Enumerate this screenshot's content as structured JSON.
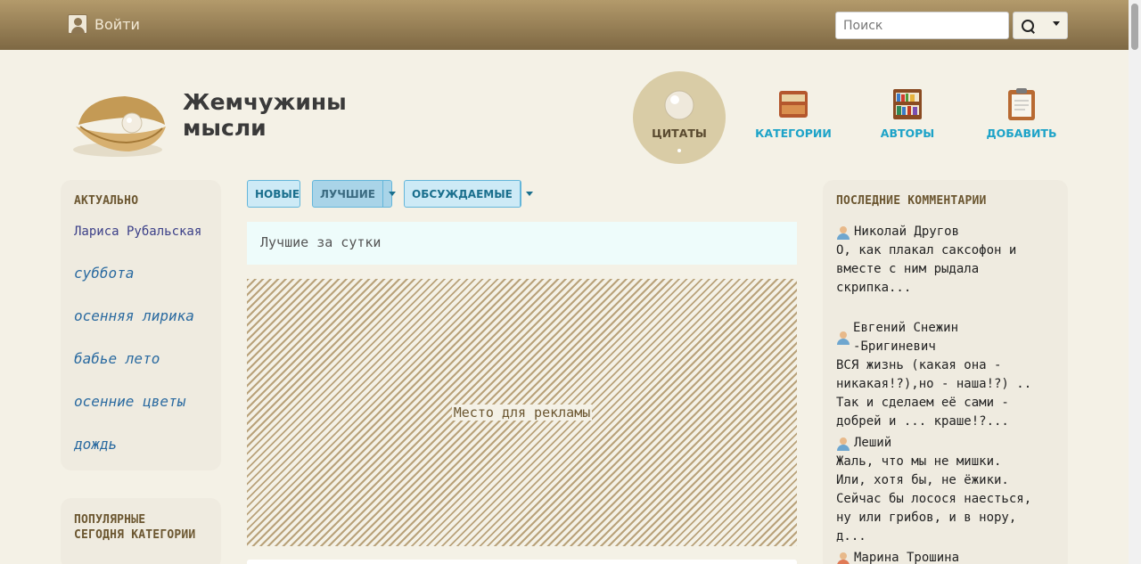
{
  "topbar": {
    "login_label": "Войти",
    "search_placeholder": "Поиск"
  },
  "header": {
    "title_line1": "Жемчужины",
    "title_line2": "мысли",
    "nav": [
      {
        "label": "ЦИТАТЫ",
        "icon": "pearl-icon",
        "active": true
      },
      {
        "label": "КАТЕГОРИИ",
        "icon": "box-icon",
        "active": false
      },
      {
        "label": "АВТОРЫ",
        "icon": "bookshelf-icon",
        "active": false
      },
      {
        "label": "ДОБАВИТЬ",
        "icon": "clipboard-icon",
        "active": false
      }
    ]
  },
  "left": {
    "actual_heading": "АКТУАЛЬНО",
    "links": [
      "Лариса Рубальская",
      "суббота",
      "осенняя лирика",
      "бабье лето",
      "осенние цветы",
      "дождь"
    ],
    "popular_heading_line1": "ПОПУЛЯРНЫЕ",
    "popular_heading_line2": "СЕГОДНЯ КАТЕГОРИИ"
  },
  "main": {
    "tabs": [
      "НОВЫЕ",
      "ЛУЧШИЕ",
      "ОБСУЖДАЕМЫЕ"
    ],
    "subheading": "Лучшие за сутки",
    "ad_text": "Место для рекламы"
  },
  "right": {
    "heading": "ПОСЛЕДНИЕ КОММЕНТАРИИ",
    "comments": [
      {
        "author": "Николай Другов",
        "text": "О, как плакал саксофон и вместе с ним рыдала скрипка..."
      },
      {
        "author": "Евгений Снежин -Бригиневич",
        "text": "ВСЯ жизнь (какая она - никакая!?),но - наша!?) .. Так и сделаем её сами - добрей и ... краше!?..."
      },
      {
        "author": "Леший",
        "text": "Жаль, что мы не мишки. Или, хотя бы, не ёжики. Сейчас бы лосося наесться, ну или грибов, и в нору, д..."
      },
      {
        "author": "Марина Трошина",
        "text": ""
      }
    ]
  },
  "colors": {
    "topbar": "#9b8258",
    "accent_link": "#1da3c8",
    "tab_bg": "#cdeaf6"
  }
}
